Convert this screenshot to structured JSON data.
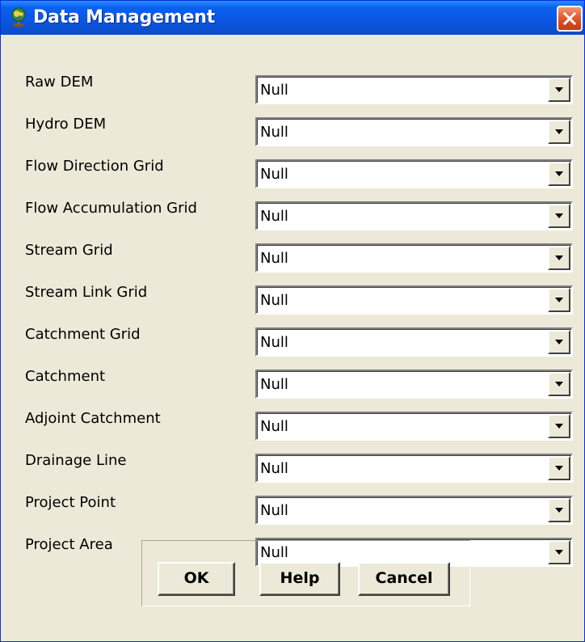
{
  "window": {
    "title": "Data Management"
  },
  "fields": [
    {
      "label": "Raw DEM",
      "value": "Null"
    },
    {
      "label": "Hydro DEM",
      "value": "Null"
    },
    {
      "label": "Flow Direction Grid",
      "value": "Null"
    },
    {
      "label": "Flow Accumulation Grid",
      "value": "Null"
    },
    {
      "label": "Stream Grid",
      "value": "Null"
    },
    {
      "label": "Stream Link Grid",
      "value": "Null"
    },
    {
      "label": "Catchment Grid",
      "value": "Null"
    },
    {
      "label": "Catchment",
      "value": "Null"
    },
    {
      "label": "Adjoint Catchment",
      "value": "Null"
    },
    {
      "label": "Drainage Line",
      "value": "Null"
    },
    {
      "label": "Project Point",
      "value": "Null"
    },
    {
      "label": "Project Area",
      "value": "Null"
    }
  ],
  "buttons": {
    "ok": "OK",
    "help": "Help",
    "cancel": "Cancel"
  },
  "colors": {
    "titlebar": "#0a55de",
    "close": "#e0552a",
    "face": "#ece9d8"
  },
  "icons": {
    "title": "globe-app-icon",
    "close": "close-icon",
    "dropdown": "chevron-down-icon"
  }
}
